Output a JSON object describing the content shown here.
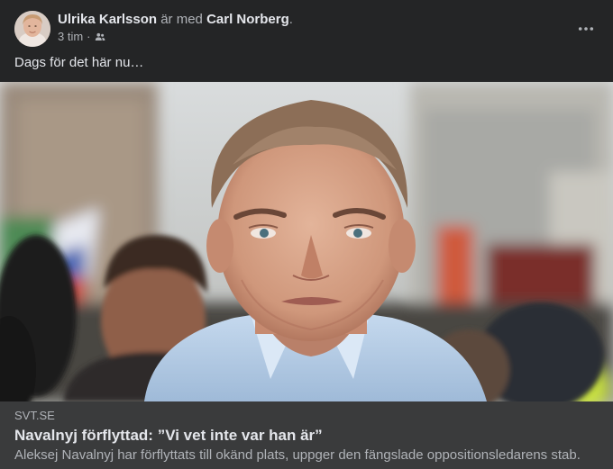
{
  "post": {
    "author": "Ulrika Karlsson",
    "connector": "är med",
    "tagged": "Carl Norberg",
    "trailing": ".",
    "time": "3 tim",
    "separator": "·",
    "audience_icon": "friends-icon",
    "more_icon": "more-options-icon",
    "text": "Dags för det här nu…"
  },
  "link": {
    "image_icon": "photo-of-man-at-rally",
    "source": "SVT.SE",
    "headline": "Navalnyj förflyttad: ”Vi vet inte var han är”",
    "description": "Aleksej Navalnyj har förflyttats till okänd plats, uppger den fängslade oppositionsledarens stab."
  },
  "colors": {
    "card_bg": "#242526",
    "link_meta_bg": "#3a3b3c",
    "primary_text": "#e4e6eb",
    "secondary_text": "#b0b3b8"
  }
}
